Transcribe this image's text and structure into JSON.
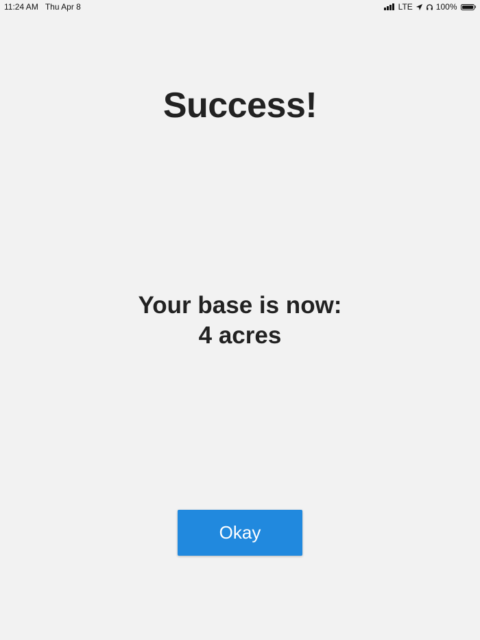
{
  "status_bar": {
    "time": "11:24 AM",
    "date": "Thu Apr 8",
    "network": "LTE",
    "battery": "100%",
    "icons": [
      "signal-icon",
      "location-arrow-icon",
      "headphones-icon",
      "battery-icon"
    ]
  },
  "screen": {
    "title": "Success!",
    "message_line1": "Your base is now:",
    "message_line2": "4 acres",
    "button_label": "Okay"
  },
  "colors": {
    "background": "#f2f2f2",
    "text": "#222222",
    "button": "#2189de",
    "button_text": "#ffffff"
  }
}
